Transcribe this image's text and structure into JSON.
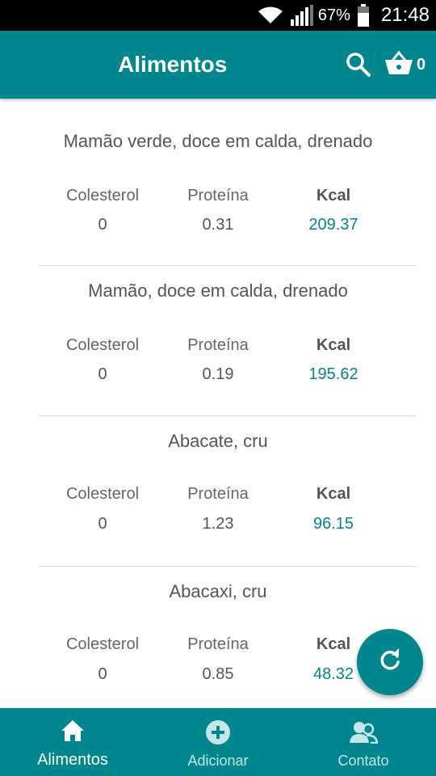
{
  "status_bar": {
    "battery": "67%",
    "time": "21:48"
  },
  "header": {
    "title": "Alimentos",
    "cart_count": "0"
  },
  "foods": [
    {
      "name": "Mamão verde, doce em calda, drenado",
      "colesterol_label": "Colesterol",
      "proteina_label": "Proteína",
      "kcal_label": "Kcal",
      "colesterol": "0",
      "proteina": "0.31",
      "kcal": "209.37"
    },
    {
      "name": "Mamão, doce em calda, drenado",
      "colesterol_label": "Colesterol",
      "proteina_label": "Proteína",
      "kcal_label": "Kcal",
      "colesterol": "0",
      "proteina": "0.19",
      "kcal": "195.62"
    },
    {
      "name": "Abacate, cru",
      "colesterol_label": "Colesterol",
      "proteina_label": "Proteína",
      "kcal_label": "Kcal",
      "colesterol": "0",
      "proteina": "1.23",
      "kcal": "96.15"
    },
    {
      "name": "Abacaxi, cru",
      "colesterol_label": "Colesterol",
      "proteina_label": "Proteína",
      "kcal_label": "Kcal",
      "colesterol": "0",
      "proteina": "0.85",
      "kcal": "48.32"
    }
  ],
  "bottom_nav": {
    "items": [
      {
        "label": "Alimentos",
        "icon": "home-icon",
        "active": true
      },
      {
        "label": "Adicionar",
        "icon": "add-circle-icon",
        "active": false
      },
      {
        "label": "Contato",
        "icon": "contacts-icon",
        "active": false
      }
    ]
  },
  "colors": {
    "primary": "#00868d",
    "kcal_value": "#00868d"
  }
}
